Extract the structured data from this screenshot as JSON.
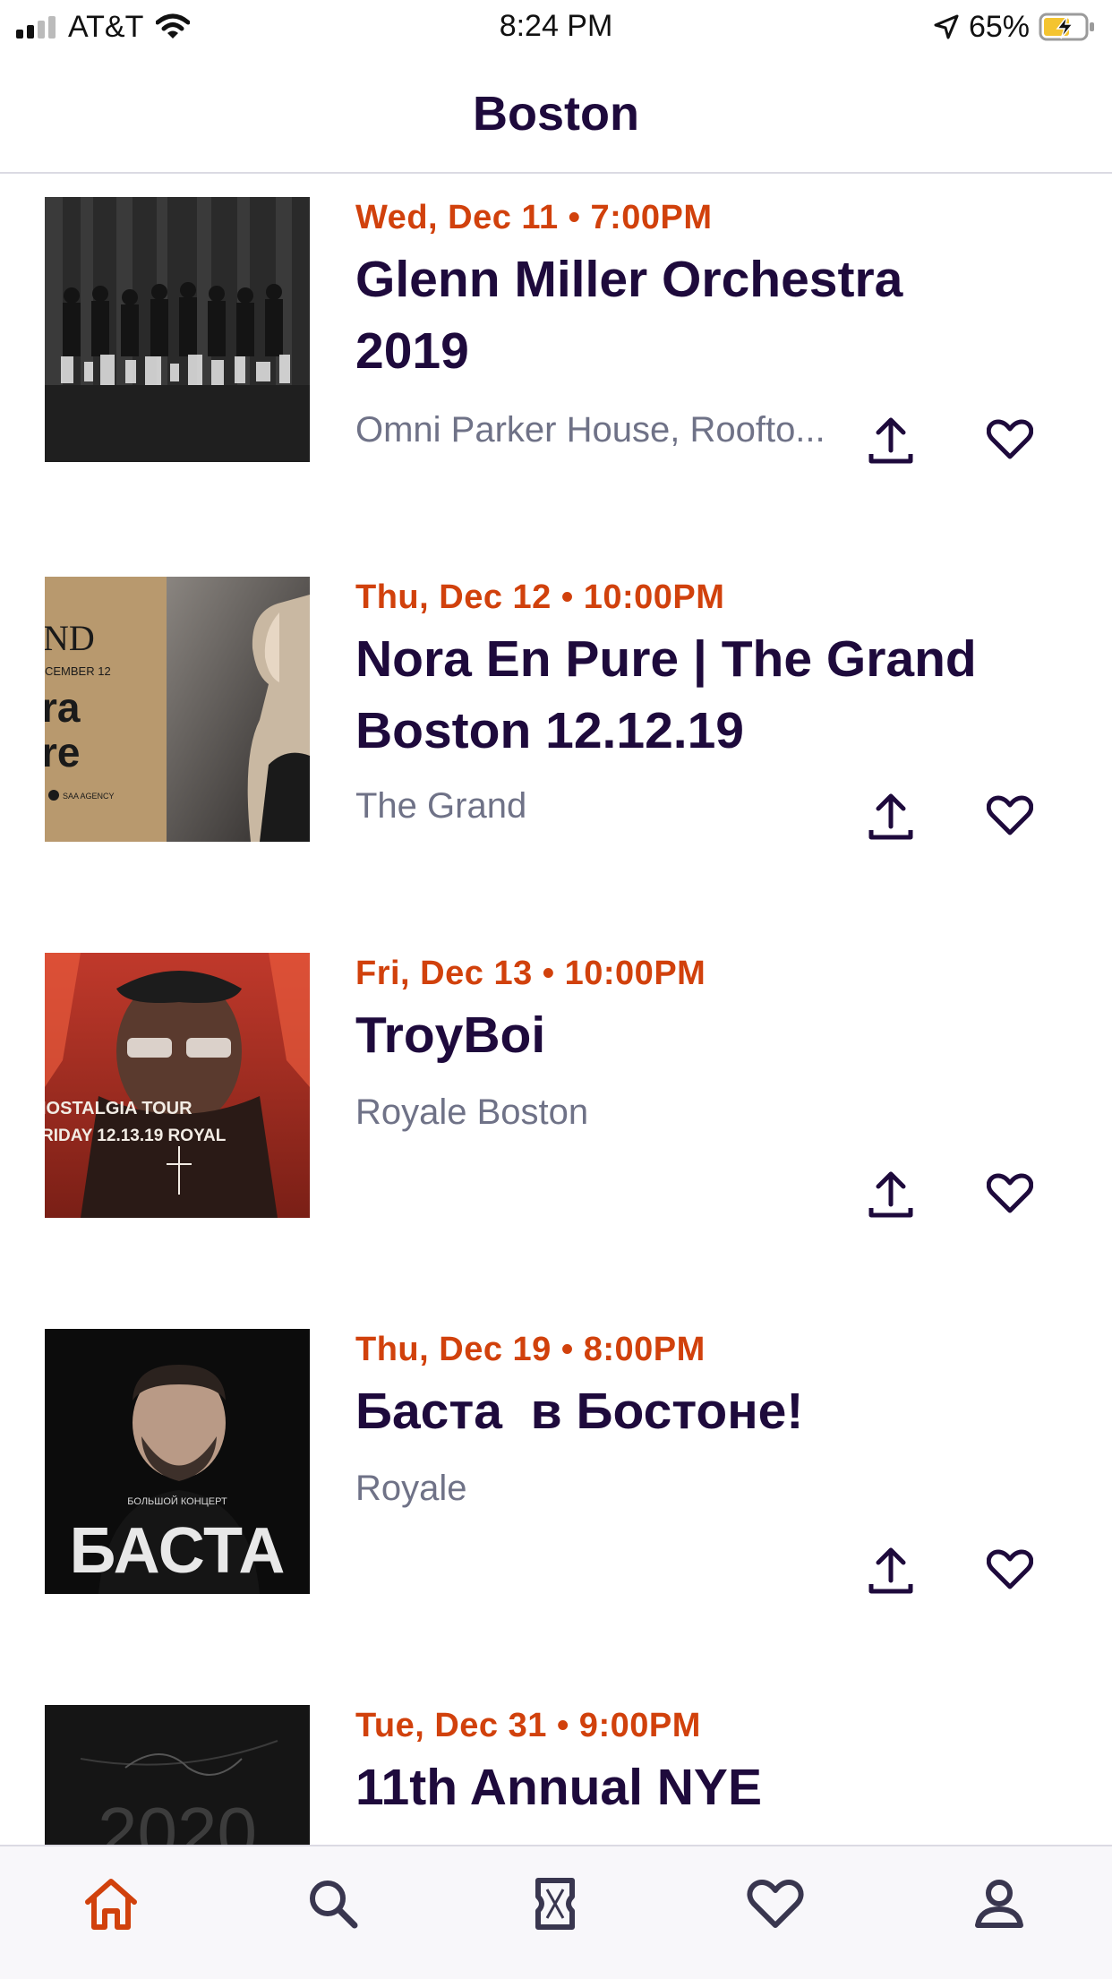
{
  "status_bar": {
    "carrier": "AT&T",
    "time": "8:24 PM",
    "battery_percent": "65%",
    "signal_bars_active": 2,
    "signal_bars_total": 4,
    "battery_level": 0.65,
    "charging": true
  },
  "header": {
    "title": "Boston"
  },
  "events": [
    {
      "date": "Wed, Dec 11 • 7:00PM",
      "title": "Glenn Miller Orchestra 2019",
      "venue": "Omni Parker House, Roofto..."
    },
    {
      "date": "Thu, Dec 12 • 10:00PM",
      "title": "Nora En Pure | The Grand Boston 12.12.19",
      "venue": "The Grand",
      "poster_text": [
        "ND",
        "CEMBER 12",
        "ra",
        "re",
        "SAA AGENCY"
      ]
    },
    {
      "date": "Fri, Dec 13 • 10:00PM",
      "title": "TroyBoi",
      "venue": "Royale Boston",
      "poster_text": [
        "IOSTALGIA TOUR",
        "RIDAY 12.13.19 ROYAL"
      ]
    },
    {
      "date": "Thu, Dec 19 • 8:00PM",
      "title": "Баста  в Бостоне!",
      "venue": "Royale",
      "poster_text": [
        "БОЛЬШОЙ КОНЦЕРТ",
        "БАСТА"
      ]
    },
    {
      "date": "Tue, Dec 31 • 9:00PM",
      "title": "11th Annual NYE",
      "venue": "",
      "poster_text": [
        "2020"
      ]
    }
  ],
  "tabs": [
    {
      "name": "home",
      "icon": "home-icon",
      "active": true
    },
    {
      "name": "search",
      "icon": "search-icon",
      "active": false
    },
    {
      "name": "tickets",
      "icon": "ticket-icon",
      "active": false
    },
    {
      "name": "likes",
      "icon": "heart-icon",
      "active": false
    },
    {
      "name": "profile",
      "icon": "user-icon",
      "active": false
    }
  ],
  "colors": {
    "accent": "#d1410c",
    "title": "#1e0a3c",
    "venue": "#6f7287",
    "tab_active": "#d1410c",
    "tab_inactive": "#39364f"
  }
}
